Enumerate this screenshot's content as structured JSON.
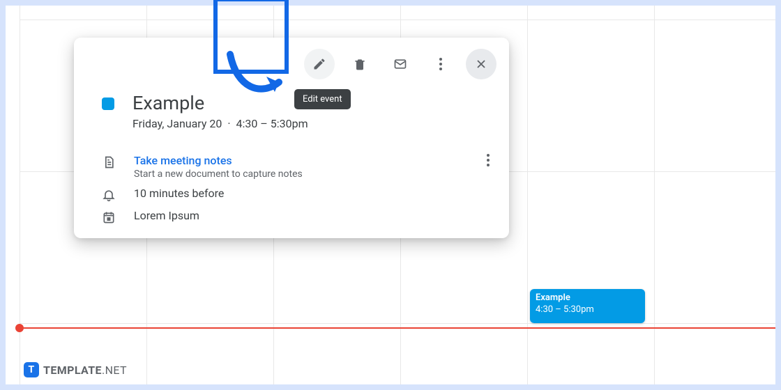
{
  "toolbar": {
    "edit_tooltip": "Edit event"
  },
  "event": {
    "title": "Example",
    "date": "Friday, January 20",
    "separator": "·",
    "time": "4:30 – 5:30pm"
  },
  "notes": {
    "link_label": "Take meeting notes",
    "sub_label": "Start a new document to capture notes"
  },
  "reminder": {
    "label": "10 minutes before"
  },
  "calendar": {
    "label": "Lorem Ipsum"
  },
  "chip": {
    "title": "Example",
    "time": "4:30 – 5:30pm"
  },
  "watermark": {
    "brand_bold": "TEMPLATE",
    "brand_light": ".NET"
  }
}
